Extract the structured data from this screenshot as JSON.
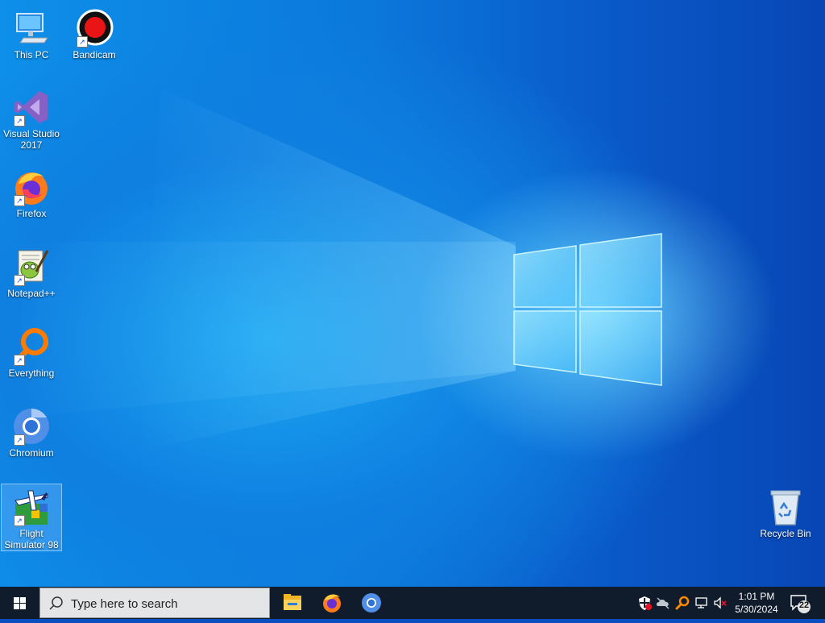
{
  "desktop_icons": [
    {
      "label": "This PC",
      "icon": "this-pc-icon",
      "shortcut": false
    },
    {
      "label": "Bandicam",
      "icon": "bandicam-icon",
      "shortcut": true
    },
    {
      "label": "Visual Studio 2017",
      "icon": "visual-studio-icon",
      "shortcut": true
    },
    {
      "label": "Firefox",
      "icon": "firefox-icon",
      "shortcut": true
    },
    {
      "label": "Notepad++",
      "icon": "notepad-plus-plus-icon",
      "shortcut": true
    },
    {
      "label": "Everything",
      "icon": "everything-icon",
      "shortcut": true
    },
    {
      "label": "Chromium",
      "icon": "chromium-icon",
      "shortcut": true
    },
    {
      "label": "Flight Simulator 98",
      "icon": "flight-simulator-icon",
      "shortcut": true,
      "selected": true
    },
    {
      "label": "Recycle Bin",
      "icon": "recycle-bin-icon",
      "shortcut": false
    }
  ],
  "taskbar": {
    "search_placeholder": "Type here to search",
    "pinned_apps": [
      "file-explorer-icon",
      "firefox-icon",
      "chromium-icon"
    ],
    "tray_icons": [
      "security-shield-icon",
      "network-cloud-icon",
      "everything-search-icon",
      "network-icon",
      "volume-muted-icon"
    ],
    "time": "1:01 PM",
    "date": "5/30/2024",
    "notification_count": "22"
  },
  "colors": {
    "taskbar": "#101c2c",
    "desktop_accent": "#0b78dc",
    "search_bg": "#e3e5e7"
  }
}
